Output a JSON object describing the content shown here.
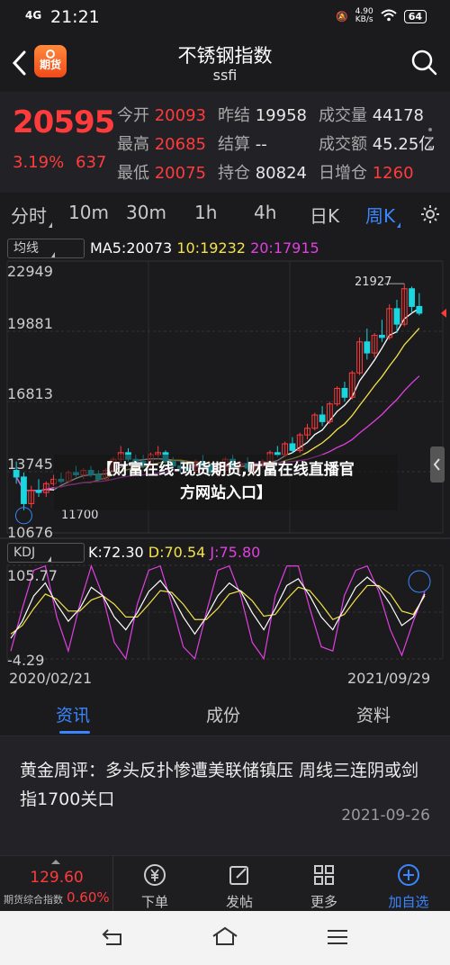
{
  "status": {
    "signal": "4G",
    "time": "21:21",
    "speed": "4.90\nKB/s",
    "speed_value": "4.90",
    "speed_unit": "KB/s",
    "battery": "64"
  },
  "header": {
    "logo_text": "期货",
    "title": "不锈钢指数",
    "subtitle": "ssfi"
  },
  "quote": {
    "price": "20595",
    "change_pct": "3.19%",
    "change": "637",
    "rows": [
      [
        {
          "label": "今开",
          "value": "20093",
          "color": "red"
        },
        {
          "label": "昨结",
          "value": "19958",
          "color": "white"
        },
        {
          "label": "成交量",
          "value": "44178",
          "color": "white"
        }
      ],
      [
        {
          "label": "最高",
          "value": "20685",
          "color": "red"
        },
        {
          "label": "结算",
          "value": "--",
          "color": "white"
        },
        {
          "label": "成交额",
          "value": "45.25亿",
          "color": "white"
        }
      ],
      [
        {
          "label": "最低",
          "value": "20075",
          "color": "red"
        },
        {
          "label": "持仓",
          "value": "80824",
          "color": "white"
        },
        {
          "label": "日增仓",
          "value": "1260",
          "color": "red"
        }
      ]
    ]
  },
  "tabs": [
    "分时",
    "10m",
    "30m",
    "1h",
    "4h",
    "日K",
    "周K"
  ],
  "active_tab": "周K",
  "main_chart": {
    "indicator": "均线",
    "ma5": "MA5:20073",
    "ma10": "10:19232",
    "ma20": "20:17915",
    "y_ticks": [
      "22949",
      "19881",
      "16813",
      "13745",
      "10676"
    ],
    "high_label": "21927",
    "low_label": "11700"
  },
  "sub_chart": {
    "indicator": "KDJ",
    "k": "K:72.30",
    "d": "D:70.54",
    "j": "J:75.80",
    "y_top": "105.77",
    "y_bottom": "-4.29"
  },
  "x_axis": {
    "start": "2020/02/21",
    "end": "2021/09/29"
  },
  "banner": {
    "line1": "【财富在线-现货期货,财富在线直播官",
    "line2": "方网站入口】"
  },
  "news_tabs": [
    "资讯",
    "成份",
    "资料"
  ],
  "news": {
    "title": "黄金周评：多头反扑惨遭美联储镇压 周线三连阴或剑指1700关口",
    "date": "2021-09-26"
  },
  "toolbar": {
    "index_value": "129.60",
    "index_label": "期货综合指数",
    "index_pct": "0.60%",
    "buttons": [
      "下单",
      "发帖",
      "更多",
      "加自选"
    ]
  },
  "colors": {
    "up": "#ff3b3b",
    "down": "#19d6e0",
    "accent": "#3a86ff",
    "ma5": "#ffffff",
    "ma10": "#f5e14a",
    "ma20": "#e040e0"
  },
  "chart_data": {
    "type": "candlestick",
    "x_range": [
      "2020/02/21",
      "2021/09/29"
    ],
    "ylim": [
      10676,
      22949
    ],
    "candles": [
      [
        13500,
        13900,
        12900,
        13200
      ],
      [
        13200,
        13400,
        11700,
        12000
      ],
      [
        12000,
        12800,
        11800,
        12600
      ],
      [
        12600,
        13100,
        12300,
        12500
      ],
      [
        12500,
        13000,
        12300,
        12900
      ],
      [
        12900,
        13300,
        12800,
        13100
      ],
      [
        13100,
        13400,
        12900,
        13000
      ],
      [
        13000,
        13500,
        12900,
        13400
      ],
      [
        13400,
        13700,
        13200,
        13300
      ],
      [
        13300,
        13600,
        13100,
        13500
      ],
      [
        13500,
        13700,
        13200,
        13300
      ],
      [
        13300,
        13500,
        13000,
        13100
      ],
      [
        13100,
        13600,
        13000,
        13500
      ],
      [
        13500,
        14100,
        13400,
        14000
      ],
      [
        14000,
        14600,
        13800,
        14300
      ],
      [
        14300,
        14500,
        13900,
        14000
      ],
      [
        14000,
        14200,
        13700,
        13900
      ],
      [
        13900,
        14200,
        13600,
        13700
      ],
      [
        13700,
        14300,
        13600,
        14200
      ],
      [
        14200,
        14600,
        14000,
        14300
      ],
      [
        14300,
        14400,
        13800,
        13900
      ],
      [
        13900,
        14100,
        13600,
        13700
      ],
      [
        13700,
        13900,
        13400,
        13600
      ],
      [
        13600,
        13800,
        13300,
        13500
      ],
      [
        13500,
        14000,
        13400,
        13900
      ],
      [
        13900,
        14200,
        13600,
        13700
      ],
      [
        13700,
        13800,
        13300,
        13400
      ],
      [
        13400,
        13700,
        13200,
        13500
      ],
      [
        13500,
        14100,
        13400,
        14000
      ],
      [
        14000,
        14200,
        13600,
        13700
      ],
      [
        13700,
        13900,
        13400,
        13800
      ],
      [
        13800,
        14100,
        13500,
        13600
      ],
      [
        13600,
        13800,
        13300,
        13700
      ],
      [
        13700,
        14000,
        13600,
        13900
      ],
      [
        13900,
        14400,
        13800,
        14300
      ],
      [
        14300,
        14600,
        14100,
        14200
      ],
      [
        14200,
        14800,
        14100,
        14700
      ],
      [
        14700,
        15000,
        14300,
        14400
      ],
      [
        14400,
        15200,
        14300,
        15100
      ],
      [
        15100,
        15600,
        14900,
        15400
      ],
      [
        15400,
        16100,
        15300,
        16000
      ],
      [
        16000,
        16400,
        15500,
        15700
      ],
      [
        15700,
        16600,
        15600,
        16500
      ],
      [
        16500,
        17300,
        16400,
        17200
      ],
      [
        17200,
        17500,
        16600,
        16800
      ],
      [
        16800,
        18000,
        16700,
        17900
      ],
      [
        17900,
        19500,
        17800,
        19300
      ],
      [
        19300,
        19900,
        18500,
        18800
      ],
      [
        18800,
        19700,
        18600,
        19600
      ],
      [
        19600,
        20300,
        19300,
        19500
      ],
      [
        19500,
        21000,
        19400,
        20800
      ],
      [
        20800,
        21200,
        19700,
        20100
      ],
      [
        20100,
        21927,
        20000,
        21700
      ],
      [
        21700,
        21800,
        20600,
        20900
      ],
      [
        20900,
        21500,
        20500,
        20595
      ]
    ],
    "kdj": {
      "range": [
        -4.29,
        105.77
      ],
      "k": [
        20,
        40,
        70,
        85,
        60,
        40,
        55,
        80,
        70,
        45,
        30,
        50,
        75,
        88,
        70,
        45,
        25,
        45,
        70,
        85,
        75,
        50,
        30,
        55,
        82,
        90,
        70,
        45,
        30,
        55,
        80,
        92,
        80,
        60,
        35,
        45,
        72
      ],
      "d": [
        25,
        35,
        55,
        72,
        66,
        52,
        52,
        65,
        70,
        60,
        45,
        45,
        60,
        76,
        74,
        60,
        42,
        42,
        55,
        72,
        76,
        64,
        46,
        48,
        66,
        80,
        76,
        60,
        42,
        48,
        66,
        82,
        82,
        72,
        52,
        48,
        70
      ],
      "j": [
        5,
        55,
        100,
        105,
        45,
        5,
        60,
        105,
        70,
        15,
        -4,
        60,
        100,
        105,
        60,
        10,
        -4,
        50,
        100,
        105,
        70,
        15,
        -4,
        70,
        105,
        105,
        55,
        10,
        5,
        70,
        100,
        105,
        75,
        30,
        0,
        40,
        75
      ]
    }
  }
}
